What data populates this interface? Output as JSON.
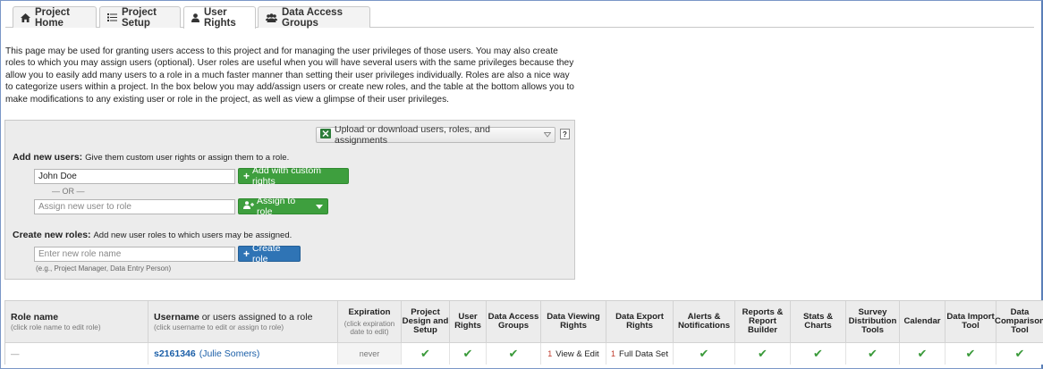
{
  "tabs": [
    {
      "label": "Project Home",
      "icon": "home-icon"
    },
    {
      "label": "Project Setup",
      "icon": "list-icon"
    },
    {
      "label": "User Rights",
      "icon": "user-icon"
    },
    {
      "label": "Data Access Groups",
      "icon": "users-icon"
    }
  ],
  "intro_text": "This page may be used for granting users access to this project and for managing the user privileges of those users. You may also create roles to which you may assign users (optional). User roles are useful when you will have several users with the same privileges because they allow you to easily add many users to a role in a much faster manner than setting their user privileges individually. Roles are also a nice way to categorize users within a project. In the box below you may add/assign users or create new roles, and the table at the bottom allows you to make modifications to any existing user or role in the project, as well as view a glimpse of their user privileges.",
  "add_box": {
    "upload_label": "Upload or download users, roles, and assignments",
    "help_label": "?",
    "add_users_title": "Add new users:",
    "add_users_desc": "Give them custom user rights or assign them to a role.",
    "username_value": "John Doe",
    "add_custom_label": "Add with custom rights",
    "or_label": "— OR —",
    "assign_placeholder": "Assign new user to role",
    "assign_button_label": "Assign to role",
    "create_roles_title": "Create new roles:",
    "create_roles_desc": "Add new user roles to which users may be assigned.",
    "role_placeholder": "Enter new role name",
    "role_example": "(e.g., Project Manager, Data Entry Person)",
    "create_role_label": "Create role"
  },
  "table": {
    "role_header": "Role name",
    "role_sub": "(click role name to edit role)",
    "user_header": "Username",
    "user_header_rest": " or users assigned to a role",
    "user_sub": "(click username to edit or assign to role)",
    "exp_header": "Expiration",
    "exp_sub": "(click expiration date to edit)",
    "columns": [
      "Project Design and Setup",
      "User Rights",
      "Data Access Groups",
      "Data Viewing Rights",
      "Data Export Rights",
      "Alerts & Notifications",
      "Reports & Report Builder",
      "Stats & Charts",
      "Survey Distribution Tools",
      "Calendar",
      "Data Import Tool",
      "Data Comparison Tool"
    ],
    "row": {
      "role": "—",
      "username": "s2161346",
      "fullname": "(Julie Somers)",
      "expiration": "never",
      "viewing_num": "1",
      "viewing": "View & Edit",
      "export_num": "1",
      "export": "Full Data Set"
    }
  }
}
